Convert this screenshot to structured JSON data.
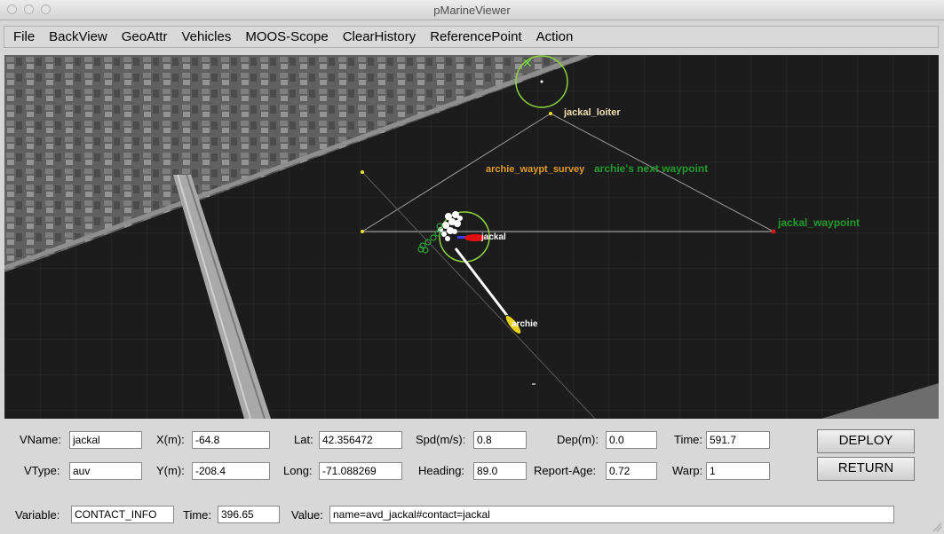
{
  "window": {
    "title": "pMarineViewer"
  },
  "menu": [
    "File",
    "BackView",
    "GeoAttr",
    "Vehicles",
    "MOOS-Scope",
    "ClearHistory",
    "ReferencePoint",
    "Action"
  ],
  "map": {
    "labels": {
      "loiter": "jackal_loiter",
      "survey": "archie_waypt_survey",
      "next_wp": "archie's next waypoint",
      "jackal_wp": "jackal_waypoint",
      "jackal": "jackal",
      "archie": "archie"
    },
    "colors": {
      "water": "#1a1a1a",
      "loiter_circle": "#8fd43a",
      "vehicle_jackal": "#e01010",
      "vehicle_archie": "#e6d21a",
      "label_orange": "#e39a1f",
      "label_green": "#1f9a2a",
      "label_tan": "#f0e0b0"
    }
  },
  "panel": {
    "vname": {
      "label": "VName:",
      "value": "jackal"
    },
    "vtype": {
      "label": "VType:",
      "value": "auv"
    },
    "x": {
      "label": "X(m):",
      "value": "-64.8"
    },
    "y": {
      "label": "Y(m):",
      "value": "-208.4"
    },
    "lat": {
      "label": "Lat:",
      "value": "42.356472"
    },
    "long": {
      "label": "Long:",
      "value": "-71.088269"
    },
    "spd": {
      "label": "Spd(m/s):",
      "value": "0.8"
    },
    "heading": {
      "label": "Heading:",
      "value": "89.0"
    },
    "dep": {
      "label": "Dep(m):",
      "value": "0.0"
    },
    "report_age": {
      "label": "Report-Age:",
      "value": "0.72"
    },
    "time": {
      "label": "Time:",
      "value": "591.7"
    },
    "warp": {
      "label": "Warp:",
      "value": "1"
    },
    "deploy_label": "DEPLOY",
    "return_label": "RETURN",
    "variable": {
      "label": "Variable:",
      "value": "CONTACT_INFO"
    },
    "var_time": {
      "label": "Time:",
      "value": "396.65"
    },
    "var_value": {
      "label": "Value:",
      "value": "name=avd_jackal#contact=jackal"
    }
  }
}
